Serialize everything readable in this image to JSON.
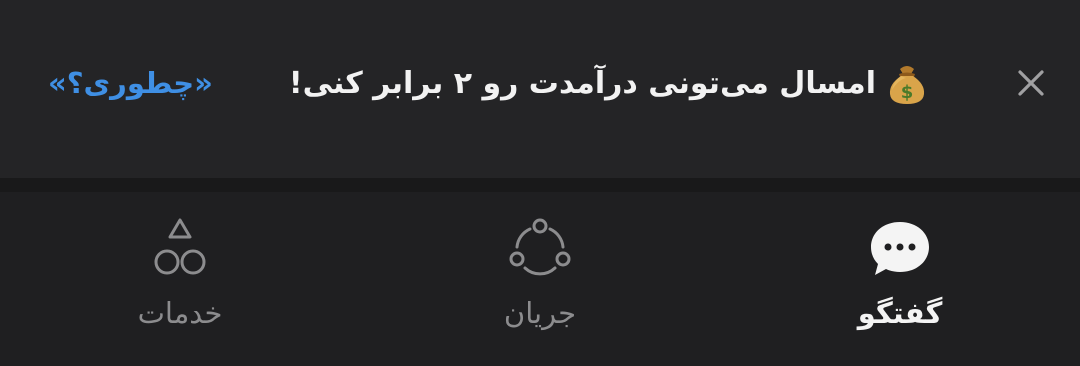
{
  "banner": {
    "message": "امسال می‌تونی درآمدت رو ۲ برابر کنی!",
    "link_label": "«چطوری؟»",
    "money_icon": "money-bag-icon",
    "close_icon": "close-icon"
  },
  "tabs": [
    {
      "key": "services",
      "label": "خدمات",
      "icon": "shapes-icon",
      "active": false
    },
    {
      "key": "stream",
      "label": "جریان",
      "icon": "stream-circle-icon",
      "active": false
    },
    {
      "key": "chat",
      "label": "گفتگو",
      "icon": "chat-bubble-icon",
      "active": true
    }
  ],
  "colors": {
    "background": "#1e1e20",
    "banner_background": "#242426",
    "link": "#3f8fe4",
    "inactive_tab": "#8c8c8e",
    "active_tab": "#f4f4f4"
  }
}
